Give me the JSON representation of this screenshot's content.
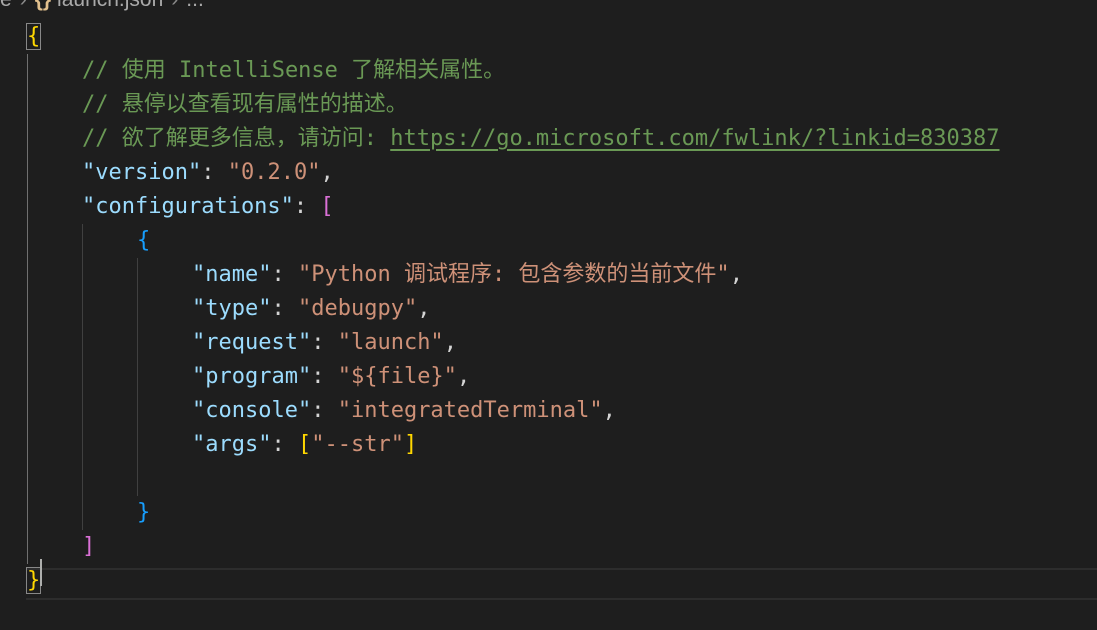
{
  "breadcrumb": {
    "prev": "e",
    "icon": "{}",
    "file": "launch.json",
    "more": "..."
  },
  "code": {
    "open_brace": "{",
    "comment1": "// 使用 IntelliSense 了解相关属性。",
    "comment2": "// 悬停以查看现有属性的描述。",
    "comment3_prefix": "// 欲了解更多信息，请访问: ",
    "comment3_link": "https://go.microsoft.com/fwlink/?linkid=830387",
    "version_key": "\"version\"",
    "version_val": "\"0.2.0\"",
    "configs_key": "\"configurations\"",
    "configs_open": "[",
    "obj_open": "{",
    "name_key": "\"name\"",
    "name_val": "\"Python 调试程序: 包含参数的当前文件\"",
    "type_key": "\"type\"",
    "type_val": "\"debugpy\"",
    "request_key": "\"request\"",
    "request_val": "\"launch\"",
    "program_key": "\"program\"",
    "program_val": "\"${file}\"",
    "console_key": "\"console\"",
    "console_val": "\"integratedTerminal\"",
    "args_key": "\"args\"",
    "args_open": "[",
    "args_val": "\"--str\"",
    "args_close": "]",
    "obj_close": "}",
    "configs_close": "]",
    "close_brace": "}",
    "colon": ": ",
    "comma": ","
  },
  "colors": {
    "background": "#1e1e1e",
    "comment": "#6a9955",
    "key": "#9cdcfe",
    "string": "#ce9178",
    "bracket_level1": "#ffd700",
    "bracket_level2": "#da70d6",
    "bracket_level3": "#179fff"
  }
}
